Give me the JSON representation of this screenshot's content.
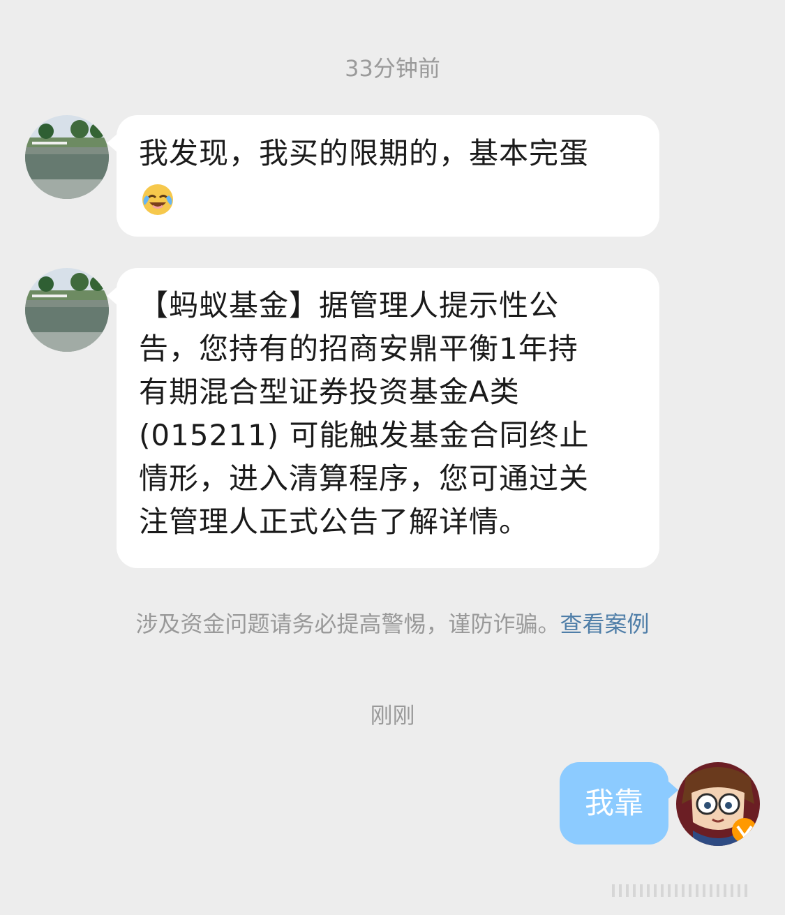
{
  "chat": {
    "timestamp_1": "33分钟前",
    "message_1": {
      "sender": "other",
      "text": "我发现，我买的限期的，基本完蛋",
      "emoji": "laughing-crying-emoji"
    },
    "message_2": {
      "sender": "other",
      "text": "【蚂蚁基金】据管理人提示性公\n告，您持有的招商安鼎平衡1年持\n有期混合型证券投资基金A类\n(015211) 可能触发基金合同终止\n情形，进入清算程序，您可通过关\n注管理人正式公告了解详情。"
    },
    "warning": {
      "text": "涉及资金问题请务必提高警惕，谨防诈骗。",
      "link": "查看案例"
    },
    "timestamp_2": "刚刚",
    "message_3": {
      "sender": "me",
      "text": "我靠"
    }
  },
  "colors": {
    "background": "#ededed",
    "bubble_other": "#ffffff",
    "bubble_me": "#8ccbff",
    "link": "#4f7ea8",
    "timestamp": "#9a9a9a"
  },
  "icons": {
    "other_avatar": "landscape-avatar",
    "my_avatar": "anime-avatar",
    "verified_badge": "verified-v-badge"
  }
}
